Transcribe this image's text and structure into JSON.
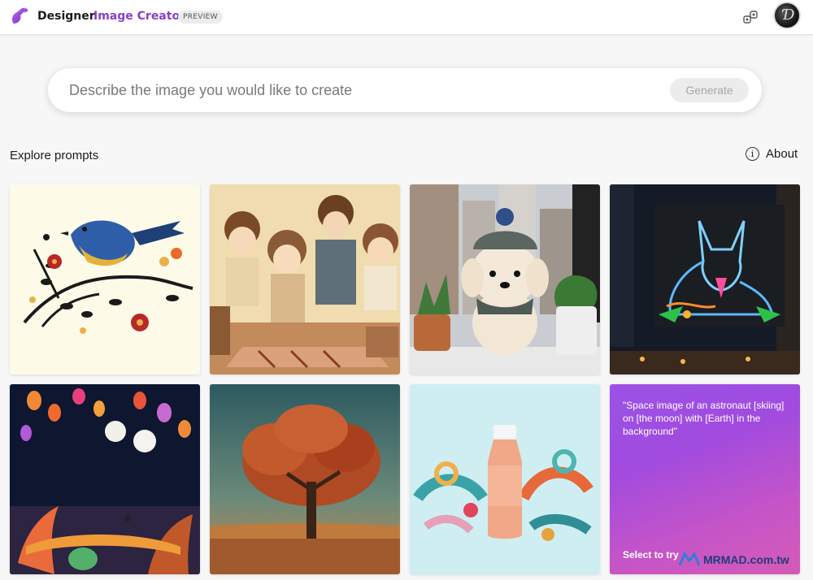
{
  "header": {
    "brand": "Designer",
    "product": "Image Creator",
    "badge": "PREVIEW"
  },
  "prompt": {
    "placeholder": "Describe the image you would like to create",
    "generate_label": "Generate"
  },
  "explore": {
    "heading": "Explore prompts",
    "about_label": "About"
  },
  "gallery": {
    "try_prompt": "\"Space image of an astronaut [skiing] on [the moon] with [Earth] in the background\"",
    "try_label": "Select to try"
  },
  "watermark": {
    "text": "MRMAD.com.tw"
  },
  "colors": {
    "accent": "#8a3fc7",
    "try_gradient_start": "#9b52e6",
    "try_gradient_end": "#d45bb7"
  },
  "icons": [
    "designer-logo-icon",
    "share-icon",
    "info-icon"
  ]
}
